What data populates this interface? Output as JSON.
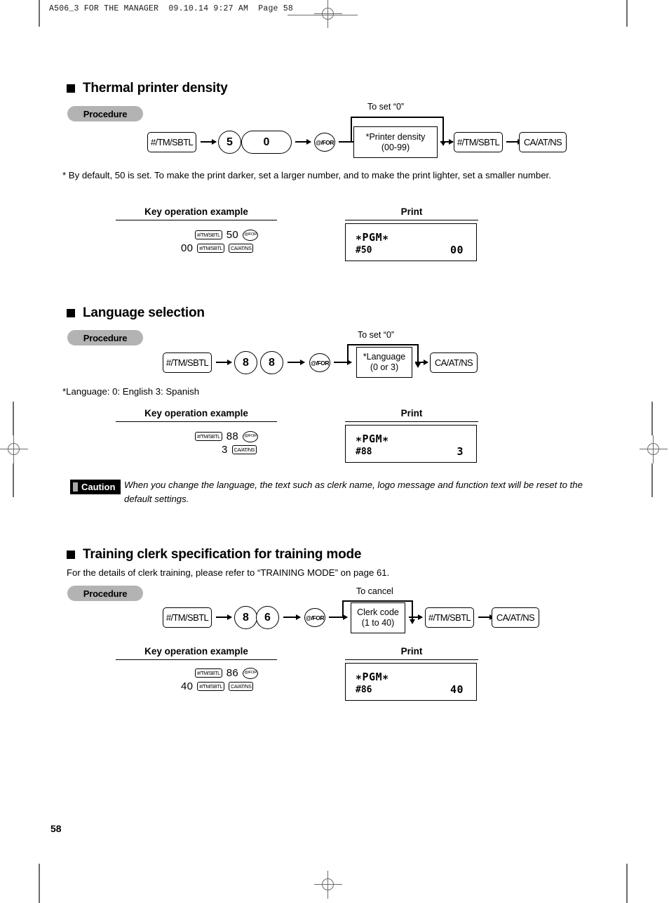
{
  "page": {
    "header_line": "A506_3 FOR THE MANAGER  09.10.14 9:27 AM  Page 58",
    "number": "58"
  },
  "labels": {
    "procedure": "Procedure",
    "key_operation_example": "Key operation example",
    "print": "Print",
    "caution": "Caution"
  },
  "sections": [
    {
      "id": "thermal-printer-density",
      "title": "Thermal printer density",
      "flow": {
        "key1": "#/TM/SBTL",
        "digit1": "5",
        "digit2": "0",
        "forkey": "@/FOR",
        "box_line1": "*Printer density",
        "box_line2": "(00-99)",
        "bypass_label": "To set “0”",
        "key2": "#/TM/SBTL",
        "key3": "CA/AT/NS"
      },
      "footnote": "* By default, 50 is set.  To make the print darker, set a larger number, and to make the print lighter, set a smaller number.",
      "example": {
        "row1": {
          "chip1": "#/TM/SBTL",
          "num": "50",
          "chip2": "@/FOR"
        },
        "row2": {
          "num": "00",
          "chip1": "#/TM/SBTL",
          "chip2": "CA/AT/NS"
        }
      },
      "receipt": {
        "line1": "∗PGM∗",
        "line2_left": "#50",
        "line2_right": "00"
      }
    },
    {
      "id": "language-selection",
      "title": "Language selection",
      "flow": {
        "key1": "#/TM/SBTL",
        "digit1": "8",
        "digit2": "8",
        "forkey": "@/FOR",
        "box_line1": "*Language",
        "box_line2": "(0 or 3)",
        "bypass_label": "To set “0”",
        "key3": "CA/AT/NS"
      },
      "footnote": "*Language: 0: English      3: Spanish",
      "example": {
        "row1": {
          "chip1": "#/TM/SBTL",
          "num": "88",
          "chip2": "@/FOR"
        },
        "row2": {
          "num": "3",
          "chip2": "CA/AT/NS"
        }
      },
      "receipt": {
        "line1": "∗PGM∗",
        "line2_left": "#88",
        "line2_right": "3"
      },
      "caution": "When you change the language, the text such as clerk name, logo message and function text will be reset to the default settings."
    },
    {
      "id": "training-clerk-specification",
      "title": "Training clerk specification for training mode",
      "intro": "For the details of clerk training, please refer to “TRAINING MODE” on page 61.",
      "flow": {
        "key1": "#/TM/SBTL",
        "digit1": "8",
        "digit2": "6",
        "forkey": "@/FOR",
        "box_line1": "Clerk code",
        "box_line2": "(1 to 40)",
        "bypass_label": "To cancel",
        "key2": "#/TM/SBTL",
        "key3": "CA/AT/NS"
      },
      "example": {
        "row1": {
          "chip1": "#/TM/SBTL",
          "num": "86",
          "chip2": "@/FOR"
        },
        "row2": {
          "num": "40",
          "chip1": "#/TM/SBTL",
          "chip2": "CA/AT/NS"
        }
      },
      "receipt": {
        "line1": "∗PGM∗",
        "line2_left": "#86",
        "line2_right": "40"
      }
    }
  ]
}
